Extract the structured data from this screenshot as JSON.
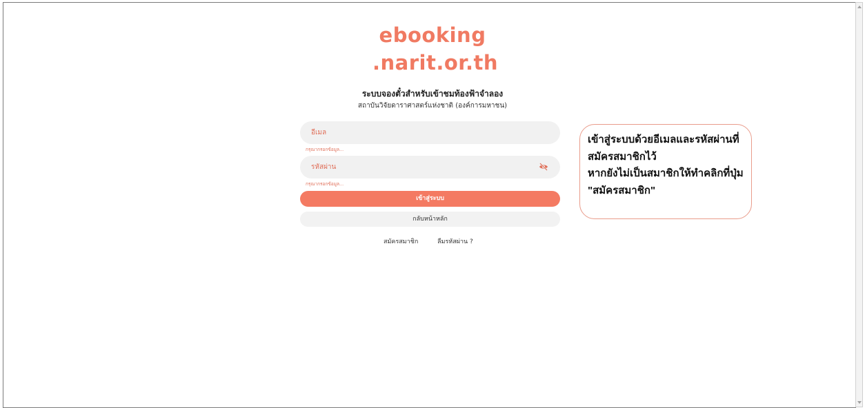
{
  "logo": {
    "line1": "ebooking",
    "line2": ".narit.or.th",
    "color": "#f07a62"
  },
  "header": {
    "title": "ระบบจองตั๋วสำหรับเข้าชมท้องฟ้าจำลอง",
    "subtitle": "สถาบันวิจัยดาราศาสตร์แห่งชาติ (องค์การมหาชน)"
  },
  "form": {
    "email_placeholder": "อีเมล",
    "email_error": "กรุณากรอกข้อมูล...",
    "password_placeholder": "รหัสผ่าน",
    "password_error": "กรุณากรอกข้อมูล...",
    "password_toggle_icon": "eye-off-icon",
    "login_label": "เข้าสู่ระบบ",
    "home_label": "กลับหน้าหลัก",
    "accent": "#f47a62"
  },
  "links": {
    "register": "สมัครสมาชิก",
    "forgot": "ลืมรหัสผ่าน ?"
  },
  "callout": {
    "lines": [
      "เข้าสู่ระบบด้วยอีเมลและรหัสผ่านที่",
      "สมัครสมาชิกไว้",
      "หากยังไม่เป็นสมาชิกให้ทำคลิกที่ปุ่ม",
      "\"สมัครสมาชิก\""
    ]
  }
}
